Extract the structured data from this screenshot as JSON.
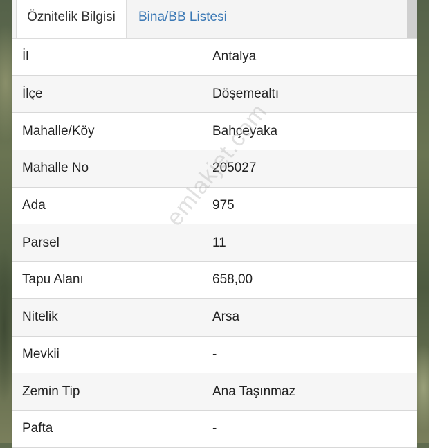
{
  "tabs": [
    {
      "label": "Öznitelik Bilgisi",
      "active": true
    },
    {
      "label": "Bina/BB Listesi",
      "active": false
    }
  ],
  "rows": [
    {
      "key": "İl",
      "value": "Antalya"
    },
    {
      "key": "İlçe",
      "value": "Döşemealtı"
    },
    {
      "key": "Mahalle/Köy",
      "value": "Bahçeyaka"
    },
    {
      "key": "Mahalle No",
      "value": "205027"
    },
    {
      "key": "Ada",
      "value": "975"
    },
    {
      "key": "Parsel",
      "value": "11"
    },
    {
      "key": "Tapu Alanı",
      "value": "658,00"
    },
    {
      "key": "Nitelik",
      "value": "Arsa"
    },
    {
      "key": "Mevkii",
      "value": "-"
    },
    {
      "key": "Zemin Tip",
      "value": "Ana Taşınmaz"
    },
    {
      "key": "Pafta",
      "value": "-"
    }
  ],
  "watermark": "emlakjet.com",
  "colors": {
    "tab_link": "#3a78b5",
    "text": "#222222",
    "row_alt": "#f6f6f6"
  }
}
